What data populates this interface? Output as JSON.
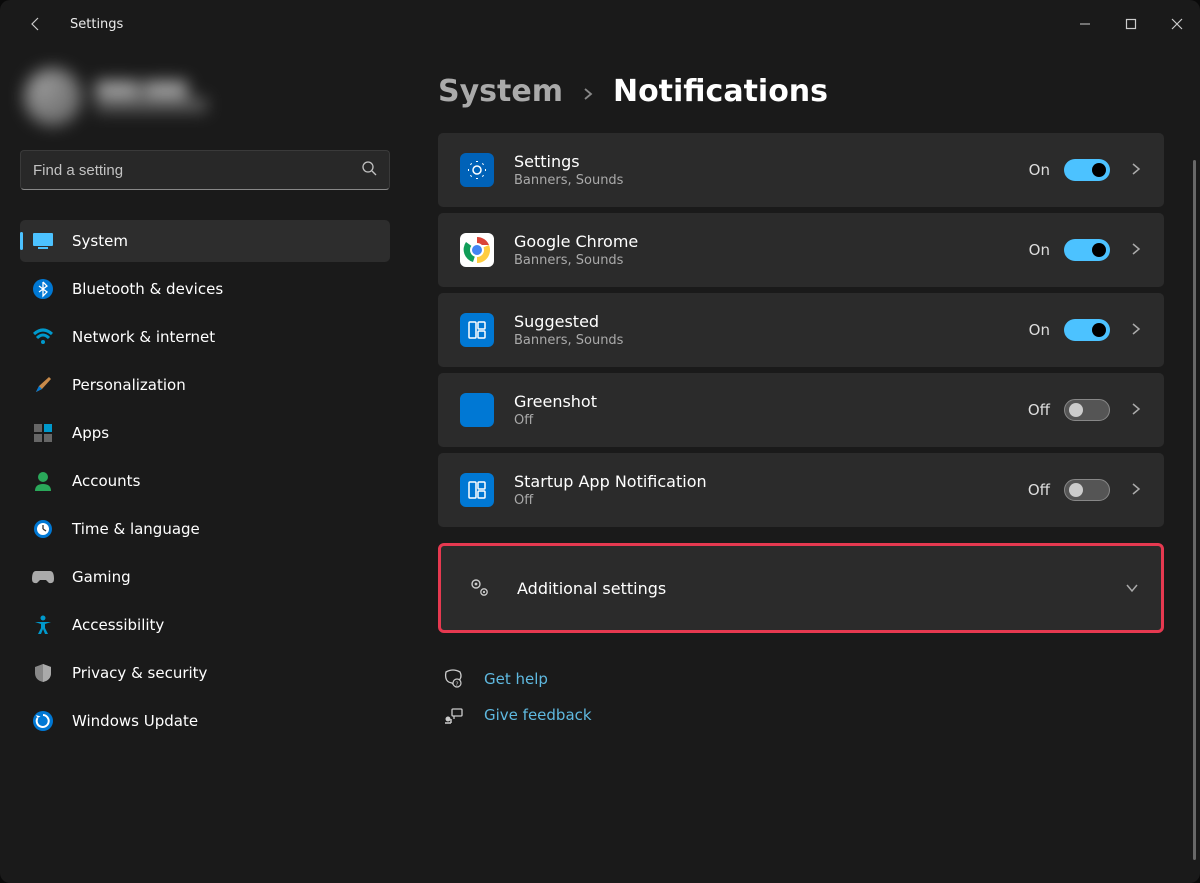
{
  "app": {
    "title": "Settings"
  },
  "breadcrumb": {
    "parent": "System",
    "current": "Notifications"
  },
  "sidebar": {
    "search_placeholder": "Find a setting",
    "items": [
      {
        "label": "System",
        "icon": "system",
        "active": true
      },
      {
        "label": "Bluetooth & devices",
        "icon": "bluetooth"
      },
      {
        "label": "Network & internet",
        "icon": "wifi"
      },
      {
        "label": "Personalization",
        "icon": "brush"
      },
      {
        "label": "Apps",
        "icon": "apps"
      },
      {
        "label": "Accounts",
        "icon": "person"
      },
      {
        "label": "Time & language",
        "icon": "clock"
      },
      {
        "label": "Gaming",
        "icon": "gamepad"
      },
      {
        "label": "Accessibility",
        "icon": "accessibility"
      },
      {
        "label": "Privacy & security",
        "icon": "shield"
      },
      {
        "label": "Windows Update",
        "icon": "update"
      }
    ]
  },
  "notifications": {
    "apps": [
      {
        "name": "Settings",
        "sub": "Banners, Sounds",
        "state_label": "On",
        "on": true,
        "icon": "settings-app"
      },
      {
        "name": "Google Chrome",
        "sub": "Banners, Sounds",
        "state_label": "On",
        "on": true,
        "icon": "chrome"
      },
      {
        "name": "Suggested",
        "sub": "Banners, Sounds",
        "state_label": "On",
        "on": true,
        "icon": "widgets"
      },
      {
        "name": "Greenshot",
        "sub": "Off",
        "state_label": "Off",
        "on": false,
        "icon": "greenshot"
      },
      {
        "name": "Startup App Notification",
        "sub": "Off",
        "state_label": "Off",
        "on": false,
        "icon": "widgets"
      }
    ],
    "additional_label": "Additional settings"
  },
  "footer": {
    "help": "Get help",
    "feedback": "Give feedback"
  }
}
